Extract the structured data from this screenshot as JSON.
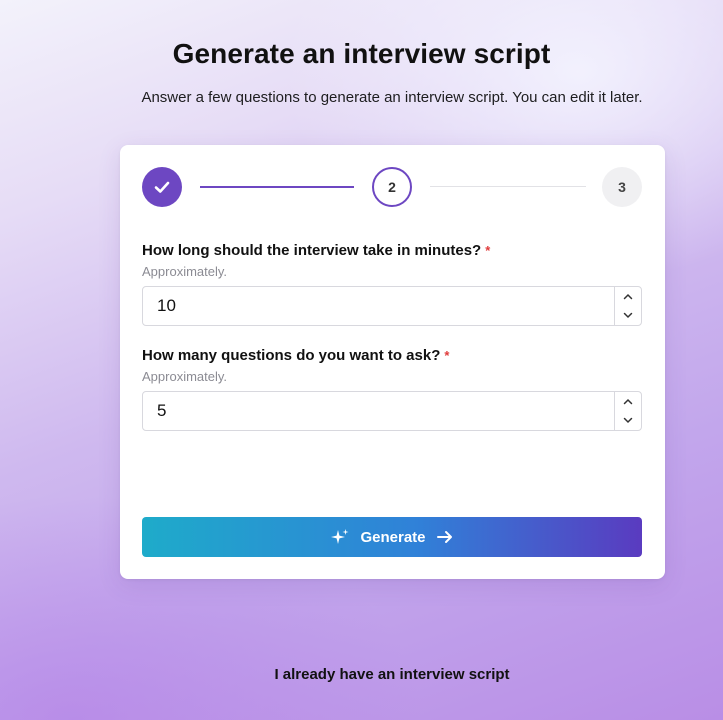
{
  "page": {
    "title": "Generate an interview script",
    "subtitle": "Answer a few questions to generate an interview script. You can edit it later."
  },
  "steps": [
    {
      "label": "",
      "state": "completed",
      "icon": "check-icon"
    },
    {
      "label": "2",
      "state": "current"
    },
    {
      "label": "3",
      "state": "upcoming"
    }
  ],
  "form": {
    "duration": {
      "label": "How long should the interview take in minutes?",
      "required_mark": "*",
      "hint": "Approximately.",
      "value": "10"
    },
    "questions": {
      "label": "How many questions do you want to ask?",
      "required_mark": "*",
      "hint": "Approximately.",
      "value": "5"
    }
  },
  "generate_button": {
    "label": "Generate",
    "icon_left": "sparkles-icon",
    "icon_right": "arrow-right-icon"
  },
  "alt_link": "I already have an interview script",
  "colors": {
    "accent": "#6d47c2",
    "required": "#e03b3b",
    "button_gradient_start": "#1eabca",
    "button_gradient_end": "#5a3bc0"
  }
}
